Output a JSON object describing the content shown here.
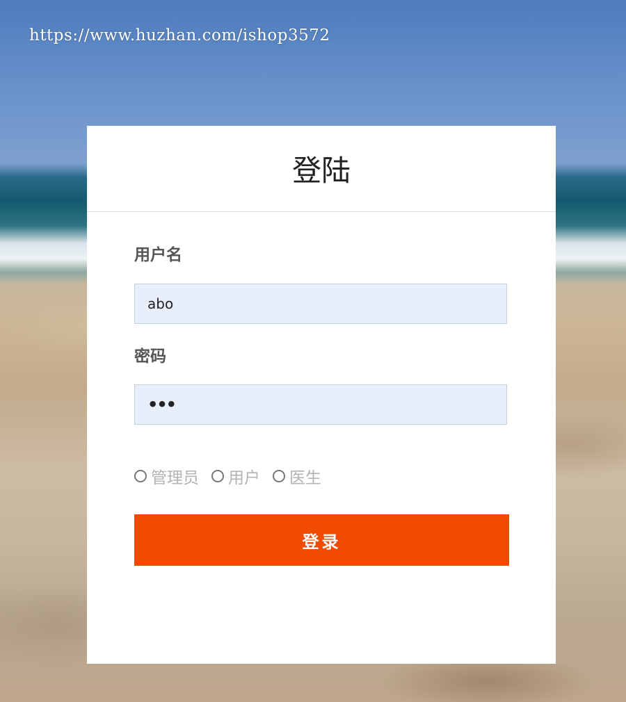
{
  "watermark": "https://www.huzhan.com/ishop3572",
  "login": {
    "title": "登陆",
    "username_label": "用户名",
    "username_value": "abo",
    "password_label": "密码",
    "password_value": "•••",
    "roles": [
      {
        "label": "管理员",
        "selected": false
      },
      {
        "label": "用户",
        "selected": false
      },
      {
        "label": "医生",
        "selected": false
      }
    ],
    "submit_label": "登录"
  },
  "colors": {
    "button_bg": "#f04b00",
    "input_bg": "#e8effb",
    "card_bg": "#ffffff"
  }
}
